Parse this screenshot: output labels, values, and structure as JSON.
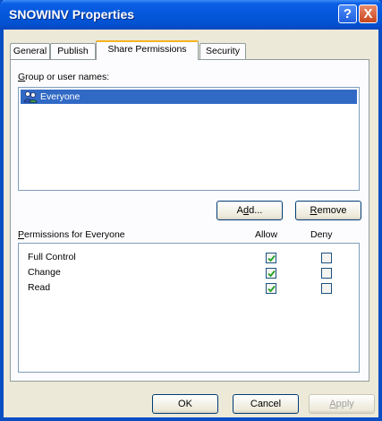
{
  "window": {
    "title": "SNOWINV Properties"
  },
  "title_buttons": {
    "help": "?",
    "close": "X"
  },
  "tabs": [
    {
      "label": "General",
      "active": false
    },
    {
      "label": "Publish",
      "active": false
    },
    {
      "label": "Share Permissions",
      "active": true
    },
    {
      "label": "Security",
      "active": false
    }
  ],
  "group_list": {
    "label_prefix": "G",
    "label_rest": "roup or user names:",
    "items": [
      {
        "label": "Everyone",
        "icon": "users-group-icon",
        "selected": true
      }
    ]
  },
  "buttons": {
    "add_prefix": "A",
    "add_mnemonic": "d",
    "add_suffix": "d...",
    "remove_mnemonic": "R",
    "remove_rest": "emove"
  },
  "permissions": {
    "label_prefix": "P",
    "label_rest": "ermissions for Everyone",
    "allow_header": "Allow",
    "deny_header": "Deny",
    "rows": [
      {
        "name": "Full Control",
        "allow": true,
        "deny": false
      },
      {
        "name": "Change",
        "allow": true,
        "deny": false
      },
      {
        "name": "Read",
        "allow": true,
        "deny": false
      }
    ]
  },
  "footer": {
    "ok": "OK",
    "cancel": "Cancel",
    "apply_mnemonic": "A",
    "apply_rest": "pply"
  },
  "colors": {
    "titlebar": "#0458dc",
    "selection": "#316ac5",
    "active_tab_accent": "#f5b323",
    "checkmark": "#21a121"
  }
}
